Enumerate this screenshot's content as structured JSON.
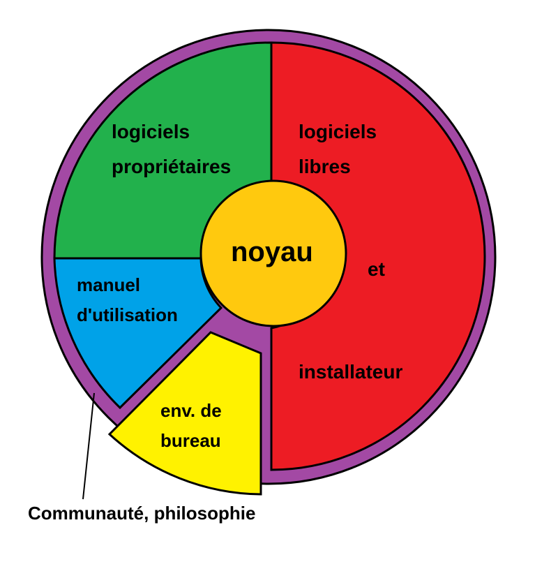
{
  "diagram": {
    "colors": {
      "ring": "#a349a4",
      "proprietary": "#22b14c",
      "free": "#ed1c24",
      "manual": "#00a2e8",
      "desktop": "#fff200",
      "core": "#ffc90e",
      "outline": "#000000"
    },
    "segments": {
      "proprietary": {
        "line1": "logiciels",
        "line2": "propriétaires"
      },
      "free": {
        "line1": "logiciels",
        "line2": "libres",
        "line3": "et",
        "line4": "installateur"
      },
      "manual": {
        "line1": "manuel",
        "line2": "d'utilisation"
      },
      "desktop": {
        "line1": "env. de",
        "line2": "bureau"
      }
    },
    "core_label": "noyau",
    "ring_label": "Communauté, philosophie"
  }
}
